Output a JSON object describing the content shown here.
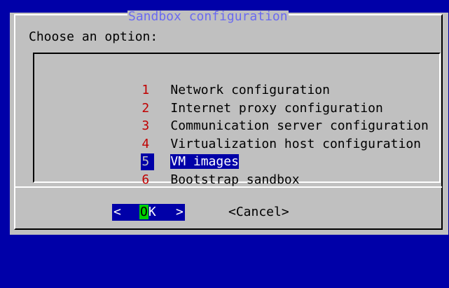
{
  "dialog": {
    "title": "Sandbox configuration",
    "prompt": "Choose an option:"
  },
  "menu": {
    "items": [
      {
        "tag": "1",
        "label": "Network configuration",
        "selected": false
      },
      {
        "tag": "2",
        "label": "Internet proxy configuration",
        "selected": false
      },
      {
        "tag": "3",
        "label": "Communication server configuration",
        "selected": false
      },
      {
        "tag": "4",
        "label": "Virtualization host configuration",
        "selected": false
      },
      {
        "tag": "5",
        "label": "VM images",
        "selected": true
      },
      {
        "tag": "6",
        "label": "Bootstrap sandbox",
        "selected": false
      }
    ]
  },
  "buttons": {
    "ok": {
      "left_bracket": "<",
      "hotkey": "O",
      "rest": "K",
      "right_bracket": ">"
    },
    "cancel": "<Cancel>"
  },
  "colors": {
    "background": "#0000a8",
    "dialog": "#c0c0c0",
    "title": "#6a6af0",
    "tag": "#c00000",
    "selection": "#0000a8",
    "hotkey": "#00d000"
  }
}
